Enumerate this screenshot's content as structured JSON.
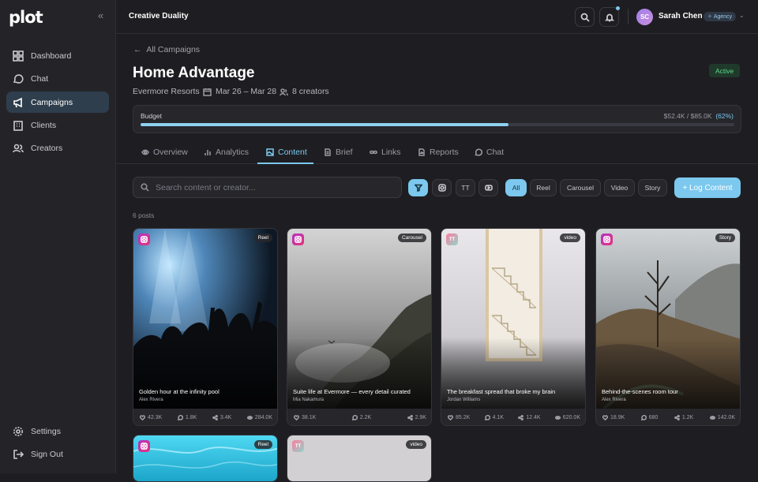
{
  "app": {
    "logo": "plot",
    "brand": "Creative Duality"
  },
  "sidebar": {
    "items": [
      {
        "label": "Dashboard",
        "icon": "grid-icon"
      },
      {
        "label": "Chat",
        "icon": "chat-icon"
      },
      {
        "label": "Campaigns",
        "icon": "megaphone-icon",
        "active": true
      },
      {
        "label": "Clients",
        "icon": "building-icon"
      },
      {
        "label": "Creators",
        "icon": "users-icon"
      }
    ],
    "bottom": [
      {
        "label": "Settings",
        "icon": "gear-icon"
      },
      {
        "label": "Sign Out",
        "icon": "signout-icon"
      }
    ]
  },
  "user": {
    "initials": "SC",
    "name": "Sarah Chen",
    "role": "Agency"
  },
  "campaign": {
    "back": "All Campaigns",
    "title": "Home Advantage",
    "status": "Active",
    "client": "Evermore Resorts",
    "dates": "Mar 26 – Mar 28",
    "creators": "8 creators",
    "budget_label": "Budget",
    "budget_value": "$52.4K / $85.0K",
    "budget_pct_label": "(62%)",
    "budget_fraction": 0.62
  },
  "tabs": [
    {
      "label": "Overview",
      "icon": "eye-icon"
    },
    {
      "label": "Analytics",
      "icon": "bars-icon"
    },
    {
      "label": "Content",
      "icon": "image-icon",
      "active": true
    },
    {
      "label": "Brief",
      "icon": "doc-icon"
    },
    {
      "label": "Links",
      "icon": "link-icon"
    },
    {
      "label": "Reports",
      "icon": "report-icon"
    },
    {
      "label": "Chat",
      "icon": "chat-icon"
    }
  ],
  "filters": {
    "search_placeholder": "Search content or creator...",
    "platform_buttons": [
      "filter-icon",
      "instagram-icon",
      "TT",
      "youtube-icon"
    ],
    "types": [
      "All",
      "Reel",
      "Carousel",
      "Video",
      "Story"
    ],
    "log_label": "+ Log Content"
  },
  "posts_count": "6 posts",
  "posts": [
    {
      "platform": "instagram",
      "type": "Reel",
      "caption": "Golden hour at the infinity pool",
      "creator": "Alex Rivera",
      "likes": "42.3K",
      "comments": "1.8K",
      "shares": "3.4K",
      "views": "284.0K",
      "scene": "concert"
    },
    {
      "platform": "instagram",
      "type": "Carousel",
      "caption": "Suite life at Evermore — every detail curated",
      "creator": "Mia Nakamura",
      "likes": "38.1K",
      "comments": "2.2K",
      "shares": "2.9K",
      "views": "",
      "scene": "mist-cliff"
    },
    {
      "platform": "tiktok",
      "type": "video",
      "caption": "The breakfast spread that broke my brain",
      "creator": "Jordan Williams",
      "likes": "85.2K",
      "comments": "4.1K",
      "shares": "12.4K",
      "views": "620.0K",
      "scene": "staircase"
    },
    {
      "platform": "instagram",
      "type": "Story",
      "caption": "Behind-the-scenes room tour",
      "creator": "Alex Rivera",
      "likes": "18.9K",
      "comments": "680",
      "shares": "1.2K",
      "views": "142.0K",
      "scene": "forest"
    },
    {
      "platform": "instagram",
      "type": "Reel",
      "caption": "",
      "creator": "",
      "scene": "pool"
    },
    {
      "platform": "tiktok",
      "type": "video",
      "caption": "",
      "creator": "",
      "scene": "grey"
    }
  ],
  "colors": {
    "accent": "#7cc8ee",
    "active_status": "#5fd98c",
    "bg": "#1e1e22"
  }
}
